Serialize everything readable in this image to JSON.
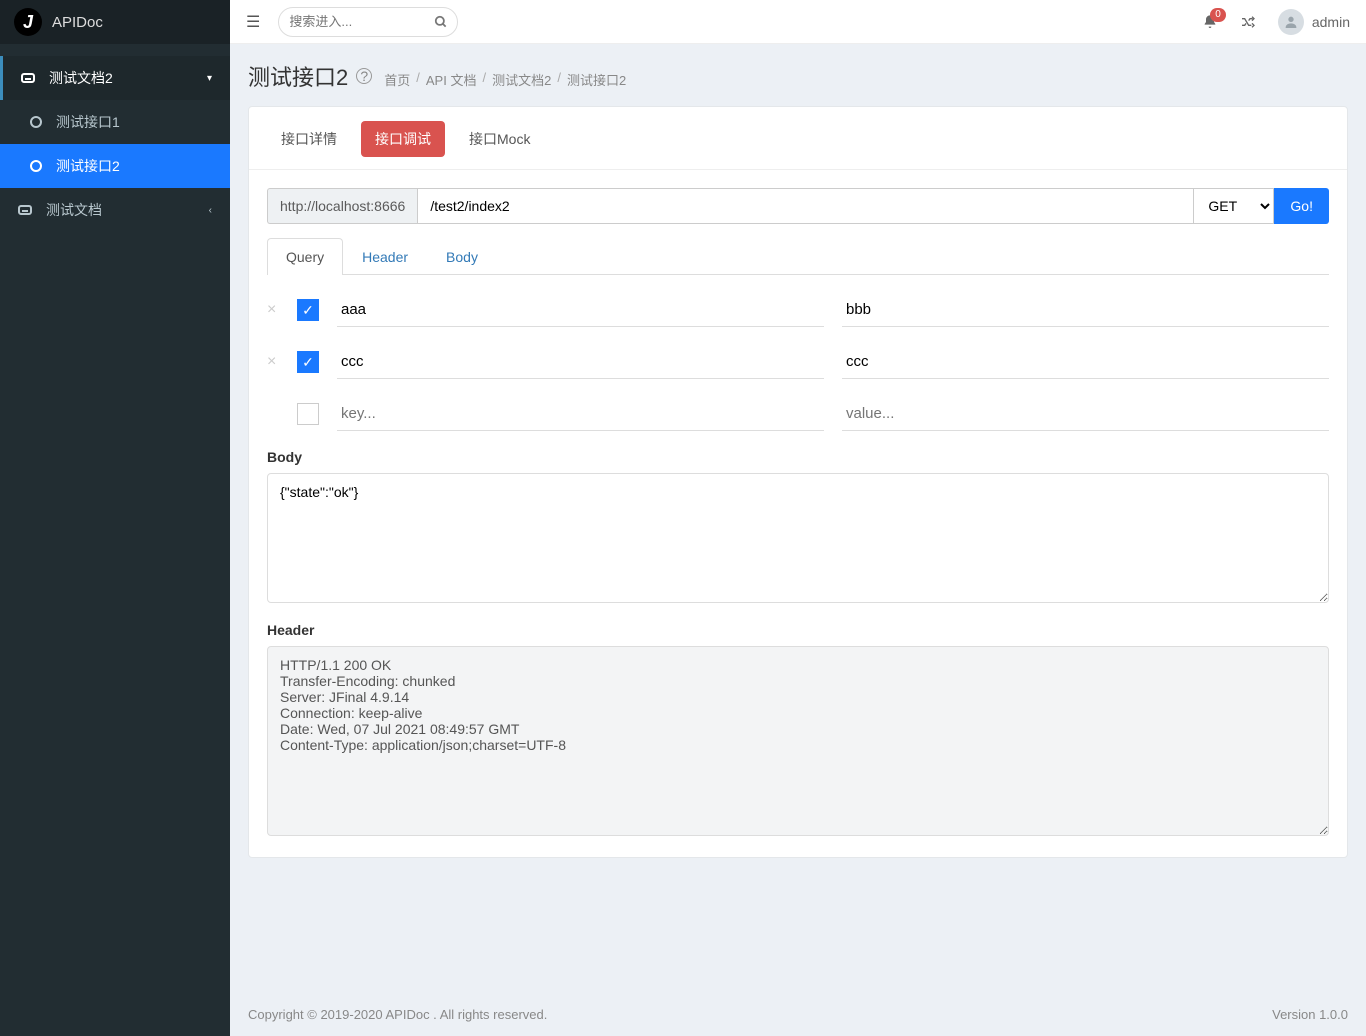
{
  "brand": "APIDoc",
  "search_placeholder": "搜索进入...",
  "notifications_count": "0",
  "username": "admin",
  "sidebar": {
    "doc2_label": "测试文档2",
    "iface1_label": "测试接口1",
    "iface2_label": "测试接口2",
    "doc_label": "测试文档"
  },
  "page_title": "测试接口2",
  "breadcrumb": {
    "home": "首页",
    "api": "API 文档",
    "doc2": "测试文档2",
    "iface2": "测试接口2"
  },
  "tabs": {
    "detail": "接口详情",
    "debug": "接口调试",
    "mock": "接口Mock"
  },
  "url_base": "http://localhost:8666",
  "url_path": "/test2/index2",
  "method": "GET",
  "go_label": "Go!",
  "subtabs": {
    "query": "Query",
    "header": "Header",
    "body": "Body"
  },
  "params": {
    "row0_key": "aaa",
    "row0_val": "bbb",
    "row1_key": "ccc",
    "row1_val": "ccc",
    "key_ph": "key...",
    "val_ph": "value..."
  },
  "body_label": "Body",
  "body_text": "{\"state\":\"ok\"}",
  "header_label": "Header",
  "header_text": "HTTP/1.1 200 OK\nTransfer-Encoding: chunked\nServer: JFinal 4.9.14\nConnection: keep-alive\nDate: Wed, 07 Jul 2021 08:49:57 GMT\nContent-Type: application/json;charset=UTF-8",
  "footer_left": "Copyright © 2019-2020 APIDoc . All rights reserved.",
  "footer_right": "Version 1.0.0"
}
